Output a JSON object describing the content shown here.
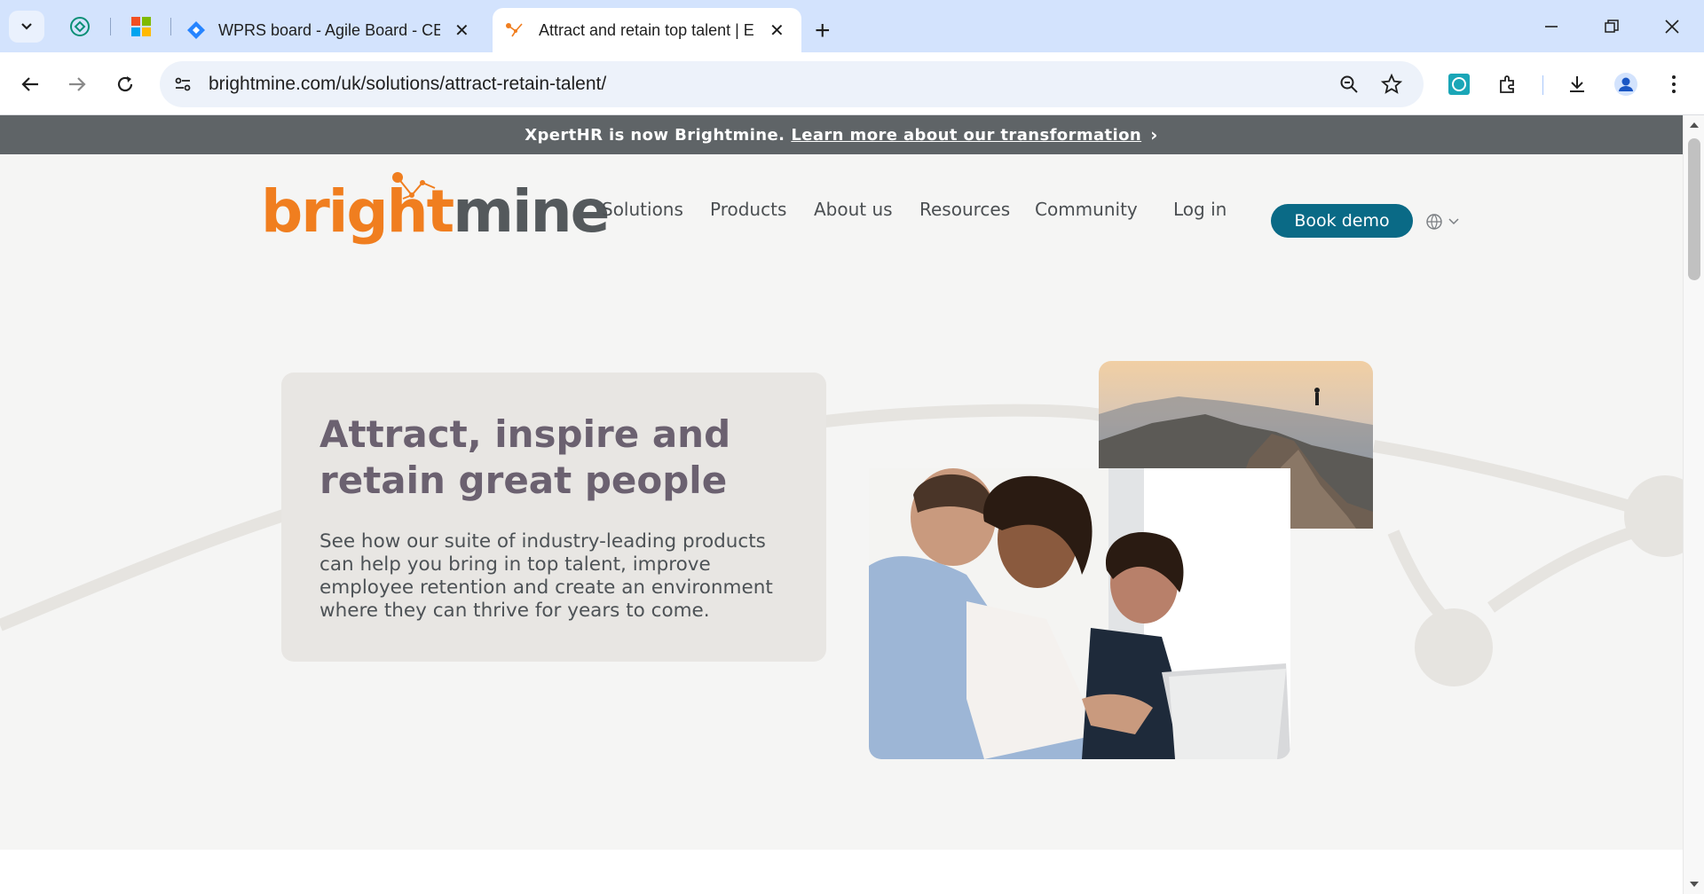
{
  "browser": {
    "tabs": [
      {
        "title": "WPRS board - Agile Board - CE",
        "icon": "jira-diamond-icon"
      },
      {
        "title": "Attract and retain top talent | E",
        "icon": "brightmine-favicon",
        "active": true
      }
    ],
    "new_tab_label": "+",
    "url": "brightmine.com/uk/solutions/attract-retain-talent/"
  },
  "banner": {
    "text": "XpertHR is now Brightmine.",
    "link": "Learn more about our transformation",
    "chevron": "›"
  },
  "logo": {
    "part1": "bright",
    "part2": "mine",
    "tm": "™"
  },
  "nav": {
    "solutions": "Solutions",
    "products": "Products",
    "about": "About us",
    "resources": "Resources",
    "community": "Community",
    "login": "Log in",
    "book_demo": "Book demo"
  },
  "hero": {
    "title": "Attract, inspire and retain great people",
    "body": "See how our suite of industry-leading products can help you bring in top talent, improve employee retention and create an environment where they can thrive for years to come."
  },
  "colors": {
    "brand_orange": "#f07e1f",
    "brand_gray": "#54595c",
    "cta_teal": "#0a6a86",
    "banner_bg": "#5f6467",
    "heading_purple": "#6b6170"
  }
}
